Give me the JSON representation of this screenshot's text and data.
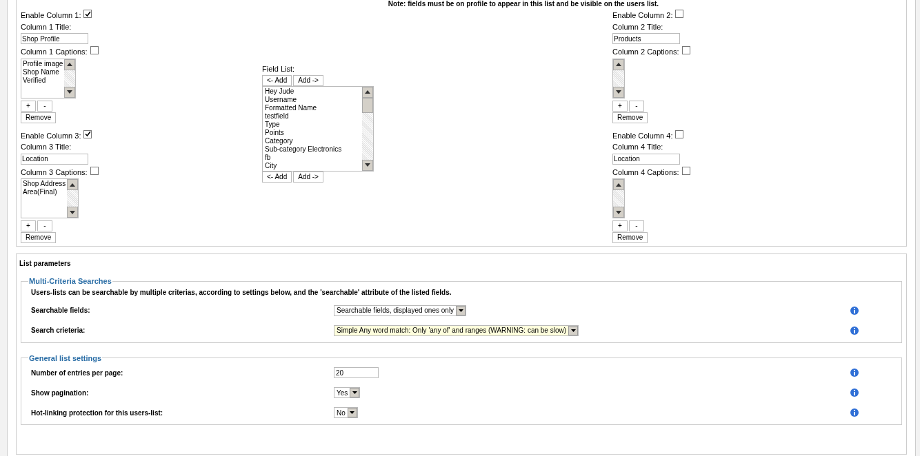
{
  "note": "Note: fields must be on profile to appear in this list and be visible on the users list.",
  "columns": [
    {
      "enable_label": "Enable Column 1:",
      "enabled": true,
      "title_label": "Column 1 Title:",
      "title_value": "Shop Profile",
      "captions_label": "Column 1 Captions:",
      "captions_checked": false,
      "captions": [
        "Profile image",
        "Shop Name",
        "Verified"
      ],
      "plus": "+",
      "minus": "-",
      "remove": "Remove"
    },
    {
      "enable_label": "Enable Column 2:",
      "enabled": false,
      "title_label": "Column 2 Title:",
      "title_value": "Products",
      "captions_label": "Column 2 Captions:",
      "captions_checked": false,
      "plus": "+",
      "minus": "-",
      "remove": "Remove"
    },
    {
      "enable_label": "Enable Column 3:",
      "enabled": true,
      "title_label": "Column 3 Title:",
      "title_value": "Location",
      "captions_label": "Column 3 Captions:",
      "captions_checked": false,
      "captions": [
        "Shop Address",
        "Area(Final)"
      ],
      "plus": "+",
      "minus": "-",
      "remove": "Remove"
    },
    {
      "enable_label": "Enable Column 4:",
      "enabled": false,
      "title_label": "Column 4 Title:",
      "title_value": "Location",
      "captions_label": "Column 4 Captions:",
      "captions_checked": false,
      "plus": "+",
      "minus": "-",
      "remove": "Remove"
    }
  ],
  "field_list": {
    "label": "Field List:",
    "top_buttons": [
      "<- Add",
      "Add ->"
    ],
    "bottom_buttons": [
      "<- Add",
      "Add ->"
    ],
    "items": [
      "Hey Jude",
      "Username",
      "Formatted Name",
      "testfield",
      "Type",
      "Points",
      "Category",
      "Sub-category Electronics",
      "fb",
      "City"
    ]
  },
  "list_parameters": {
    "title": "List parameters",
    "sections": [
      {
        "legend": "Multi-Criteria Searches",
        "description": "Users-lists can be searchable by multiple criterias, according to settings below, and the 'searchable' attribute of the listed fields.",
        "rows": [
          {
            "label": "Searchable fields:",
            "kind": "select",
            "value": "Searchable fields, displayed ones only",
            "highlighted": false
          },
          {
            "label": "Search crieteria:",
            "kind": "select",
            "value": "Simple Any word match: Only 'any of' and ranges (WARNING: can be slow)",
            "highlighted": true
          }
        ]
      },
      {
        "legend": "General list settings",
        "rows": [
          {
            "label": "Number of entries per page:",
            "kind": "text",
            "value": "20",
            "highlighted": false
          },
          {
            "label": "Show pagination:",
            "kind": "select",
            "value": "Yes",
            "highlighted": false
          },
          {
            "label": "Hot-linking protection for this users-list:",
            "kind": "select",
            "value": "No",
            "highlighted": false
          }
        ]
      }
    ]
  }
}
